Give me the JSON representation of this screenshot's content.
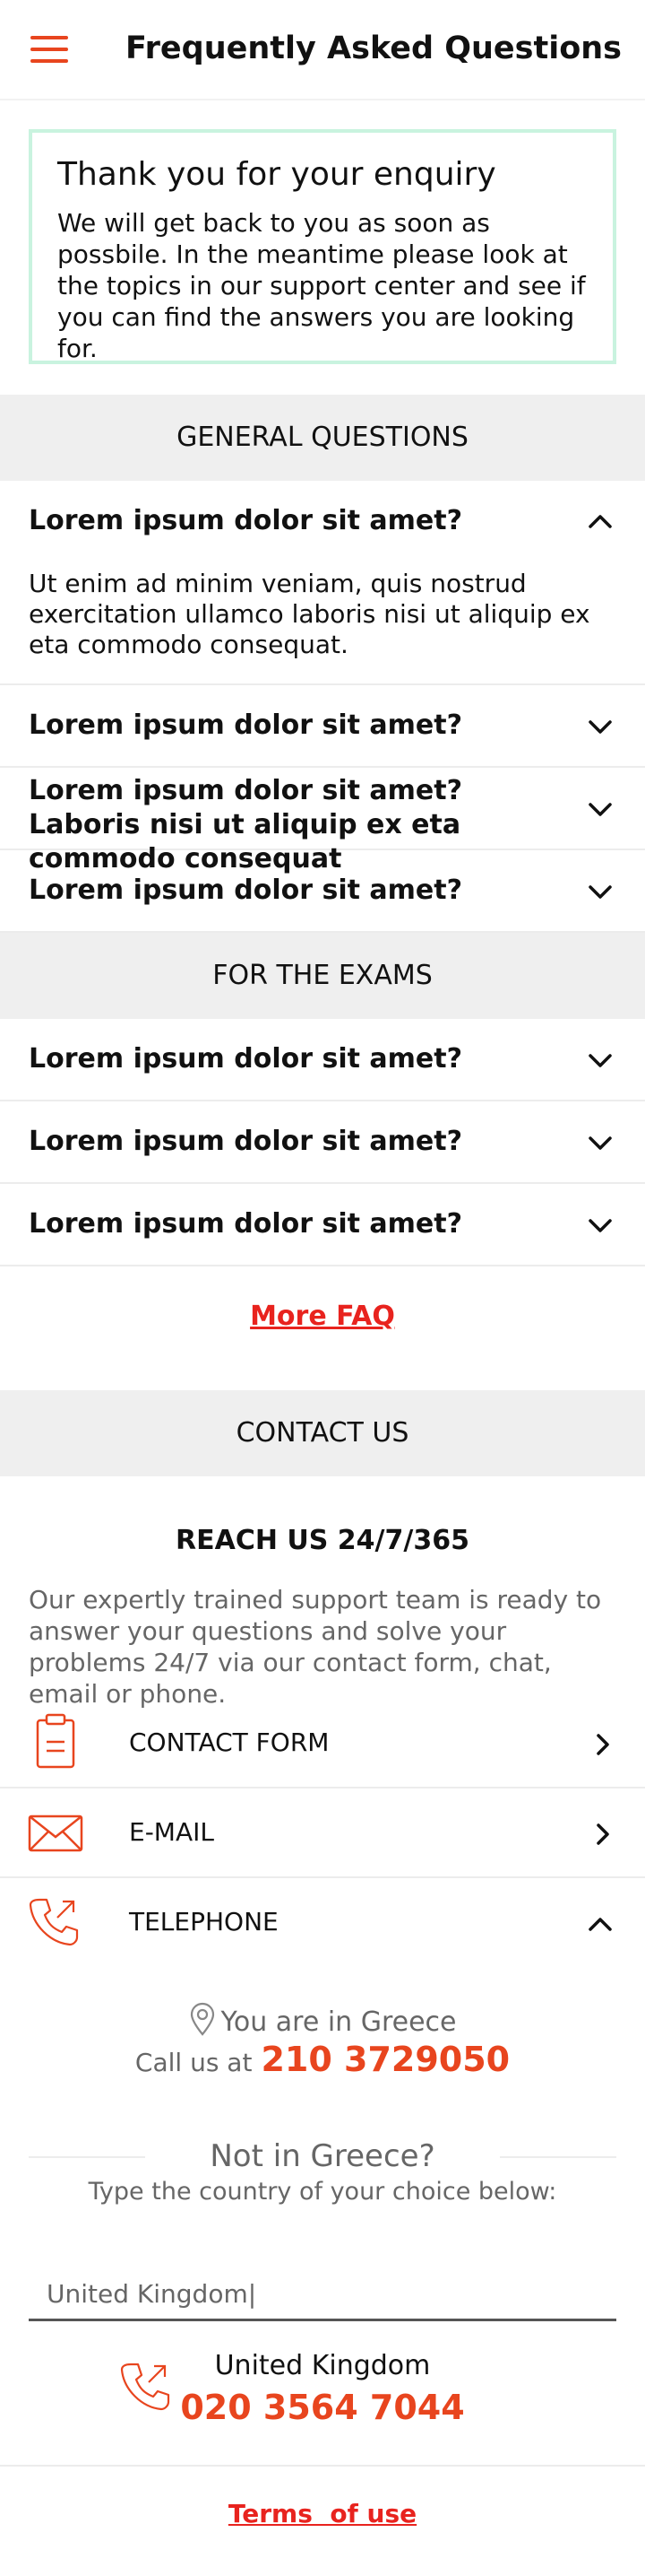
{
  "header": {
    "title": "Frequently Asked Questions",
    "menu_icon": "hamburger-menu-icon"
  },
  "notice": {
    "title": "Thank you for your enquiry",
    "body": "We will get back to you as soon as possbile. In the meantime please look at the topics in our support center and see if you can find the answers you are looking for."
  },
  "sections": {
    "general": "GENERAL QUESTIONS",
    "exams": "FOR THE EXAMS",
    "contact": "CONTACT US"
  },
  "general_faq": [
    {
      "question": "Lorem ipsum dolor sit amet?",
      "answer": "Ut enim ad minim veniam, quis nostrud exercitation ullamco laboris nisi ut aliquip ex eta commodo consequat.",
      "expanded": true
    },
    {
      "question": "Lorem ipsum dolor sit amet?",
      "expanded": false
    },
    {
      "question": "Lorem ipsum dolor sit amet? Laboris nisi ut aliquip ex eta commodo consequat",
      "expanded": false
    },
    {
      "question": "Lorem ipsum dolor sit amet?",
      "expanded": false
    }
  ],
  "exam_faq": [
    {
      "question": "Lorem ipsum dolor sit amet?",
      "expanded": false
    },
    {
      "question": "Lorem ipsum dolor sit amet?",
      "expanded": false
    },
    {
      "question": "Lorem ipsum dolor sit amet?",
      "expanded": false
    }
  ],
  "more_faq": "More FAQ",
  "contact": {
    "reach_title": "REACH US 24/7/365",
    "reach_text": "Our expertly trained support team is ready to answer your questions and solve your problems 24/7 via our contact form, chat, email or phone.",
    "options": [
      {
        "label": "CONTACT FORM",
        "icon": "clipboard-icon",
        "expanded": false
      },
      {
        "label": "E-MAIL",
        "icon": "envelope-icon",
        "expanded": false
      },
      {
        "label": "TELEPHONE",
        "icon": "phone-icon",
        "expanded": true
      }
    ],
    "location_text": "You are in Greece",
    "call_us_label": "Call us at",
    "greece_number": "210 3729050",
    "not_in_greece": "Not in Greece?",
    "type_country": "Type the country of your choice below:",
    "country_input_value": "United Kingdom|",
    "result_country": "United Kingdom",
    "result_number": "020 3564 7044"
  },
  "footer": {
    "terms": "Terms  of use"
  },
  "colors": {
    "accent": "#e8451e",
    "link": "#e8231e",
    "notice_border": "#c9f3df",
    "band": "#efefef"
  }
}
